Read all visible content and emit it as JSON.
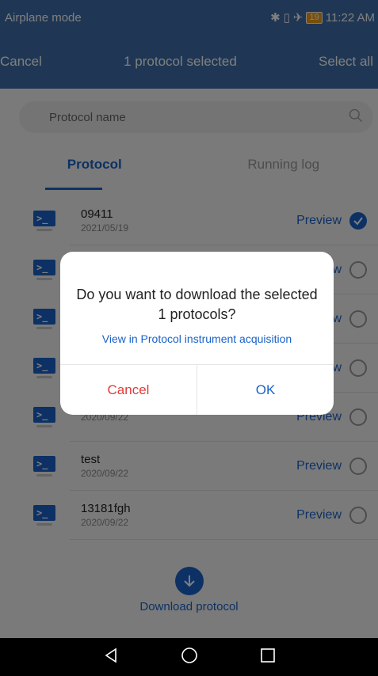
{
  "status": {
    "left_text": "Airplane mode",
    "battery": "19",
    "time": "11:22 AM"
  },
  "navbar": {
    "cancel": "Cancel",
    "title": "1 protocol selected",
    "select_all": "Select all"
  },
  "search": {
    "placeholder": "Protocol name"
  },
  "tabs": [
    {
      "label": "Protocol",
      "active": true
    },
    {
      "label": "Running log",
      "active": false
    }
  ],
  "items": [
    {
      "name": "09411",
      "date": "2021/05/19",
      "preview": "Preview",
      "checked": true
    },
    {
      "name": "",
      "date": "",
      "preview": "Preview",
      "checked": false
    },
    {
      "name": "",
      "date": "",
      "preview": "Preview",
      "checked": false
    },
    {
      "name": "",
      "date": "",
      "preview": "Preview",
      "checked": false
    },
    {
      "name": "",
      "date": "2020/09/22",
      "preview": "Preview",
      "checked": false
    },
    {
      "name": "test",
      "date": "2020/09/22",
      "preview": "Preview",
      "checked": false
    },
    {
      "name": "13181fgh",
      "date": "2020/09/22",
      "preview": "Preview",
      "checked": false
    }
  ],
  "download": {
    "label": "Download protocol"
  },
  "dialog": {
    "message": "Do you want to download the selected 1 protocols?",
    "link": "View in Protocol instrument acquisition",
    "cancel": "Cancel",
    "ok": "OK"
  },
  "colors": {
    "accent": "#1a62c9",
    "danger": "#e03b3b"
  }
}
